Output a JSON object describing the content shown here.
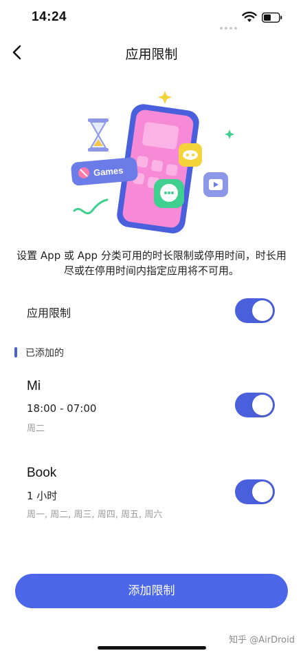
{
  "status_bar": {
    "time": "14:24"
  },
  "nav": {
    "title": "应用限制"
  },
  "hero": {
    "badge_label": "Games"
  },
  "description": "设置 App 或 App 分类可用的时长限制或停用时间，时长用尽或在停用时间内指定应用将不可用。",
  "app_limit": {
    "label": "应用限制",
    "enabled": true
  },
  "section": {
    "title": "已添加的"
  },
  "rules": [
    {
      "name": "Mi",
      "time": "18:00 - 07:00",
      "days": "周二",
      "enabled": true
    },
    {
      "name": "Book",
      "time": "1 小时",
      "days": "周一, 周二, 周三, 周四, 周五, 周六",
      "enabled": true
    }
  ],
  "add_button": {
    "label": "添加限制"
  },
  "watermark": "知乎 @AirDroid",
  "colors": {
    "accent": "#4a5fdb",
    "button": "#4b66e8"
  }
}
